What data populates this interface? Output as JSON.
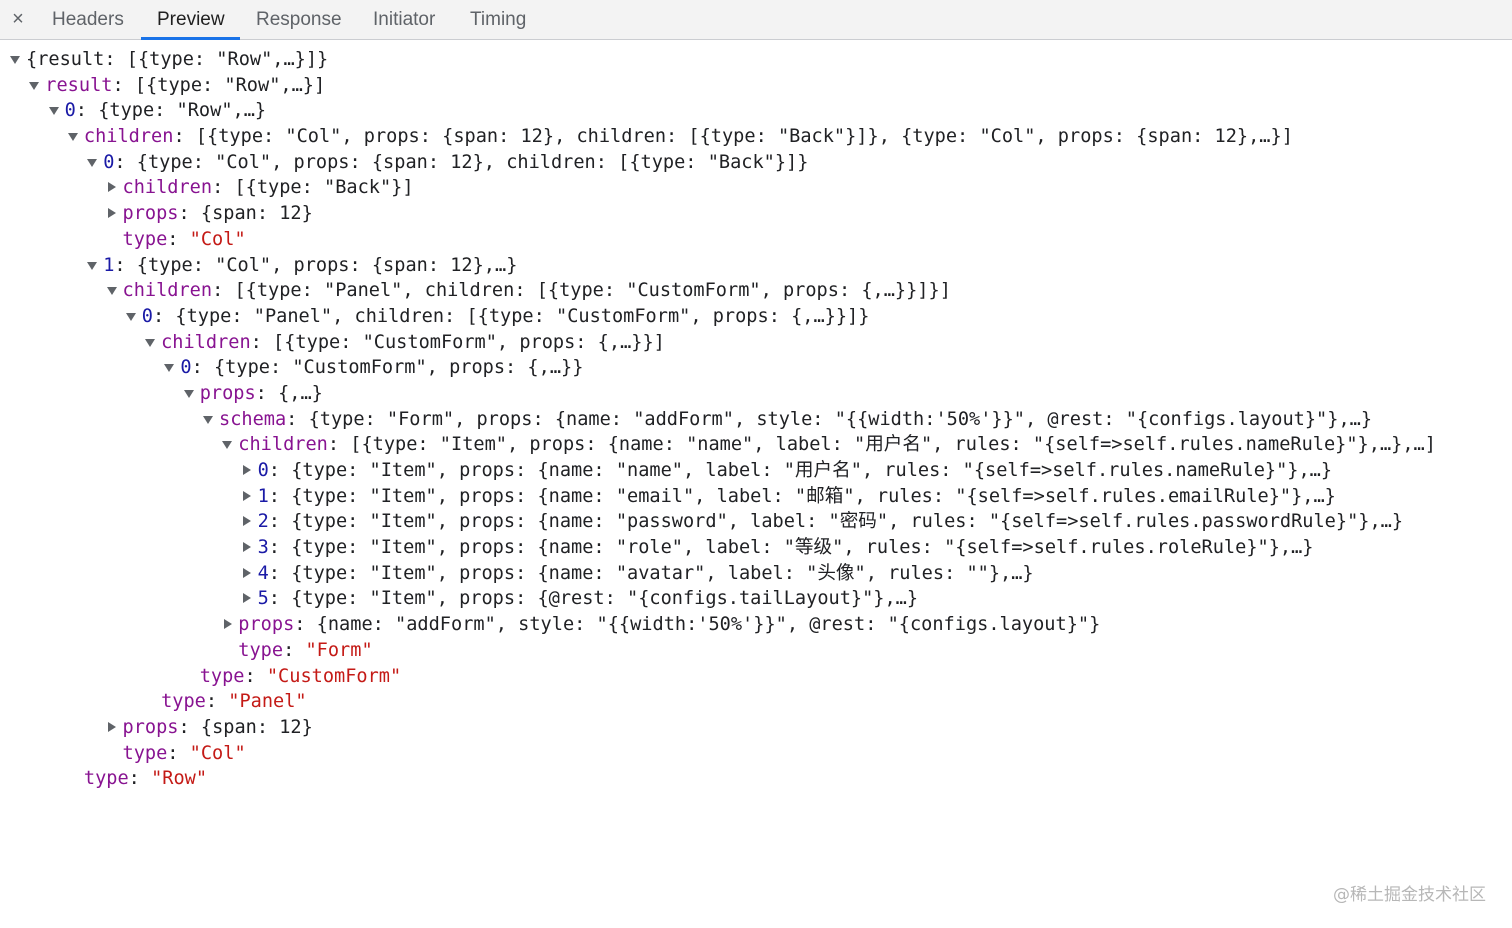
{
  "tabs": {
    "close_icon": "×",
    "items": [
      {
        "label": "Headers",
        "active": false
      },
      {
        "label": "Preview",
        "active": true
      },
      {
        "label": "Response",
        "active": false
      },
      {
        "label": "Initiator",
        "active": false
      },
      {
        "label": "Timing",
        "active": false
      }
    ]
  },
  "tree": {
    "lines": [
      {
        "key": "",
        "value": "{result: [{type: \"Row\",…}]}",
        "expanded": true
      },
      {
        "key": "result",
        "value": "[{type: \"Row\",…}]",
        "expanded": true
      },
      {
        "key": "0",
        "value": "{type: \"Row\",…}",
        "expanded": true
      },
      {
        "key": "children",
        "value": "[{type: \"Col\", props: {span: 12}, children: [{type: \"Back\"}]}, {type: \"Col\", props: {span: 12},…}]",
        "expanded": true
      },
      {
        "key": "0",
        "value": "{type: \"Col\", props: {span: 12}, children: [{type: \"Back\"}]}",
        "expanded": true
      },
      {
        "key": "children",
        "value": "[{type: \"Back\"}]",
        "expanded": false
      },
      {
        "key": "props",
        "value": "{span: 12}",
        "expanded": false
      },
      {
        "key": "type",
        "value": "\"Col\""
      },
      {
        "key": "1",
        "value": "{type: \"Col\", props: {span: 12},…}",
        "expanded": true
      },
      {
        "key": "children",
        "value": "[{type: \"Panel\", children: [{type: \"CustomForm\", props: {,…}}]}]",
        "expanded": true
      },
      {
        "key": "0",
        "value": "{type: \"Panel\", children: [{type: \"CustomForm\", props: {,…}}]}",
        "expanded": true
      },
      {
        "key": "children",
        "value": "[{type: \"CustomForm\", props: {,…}}]",
        "expanded": true
      },
      {
        "key": "0",
        "value": "{type: \"CustomForm\", props: {,…}}",
        "expanded": true
      },
      {
        "key": "props",
        "value": "{,…}",
        "expanded": true
      },
      {
        "key": "schema",
        "value": "{type: \"Form\", props: {name: \"addForm\", style: \"{{width:'50%'}}\", @rest: \"{configs.layout}\"},…}",
        "expanded": true
      },
      {
        "key": "children",
        "value": "[{type: \"Item\", props: {name: \"name\", label: \"用户名\", rules: \"{self=>self.rules.nameRule}\"},…},…]",
        "expanded": true
      },
      {
        "key": "0",
        "value": "{type: \"Item\", props: {name: \"name\", label: \"用户名\", rules: \"{self=>self.rules.nameRule}\"},…}",
        "expanded": false
      },
      {
        "key": "1",
        "value": "{type: \"Item\", props: {name: \"email\", label: \"邮箱\", rules: \"{self=>self.rules.emailRule}\"},…}",
        "expanded": false
      },
      {
        "key": "2",
        "value": "{type: \"Item\", props: {name: \"password\", label: \"密码\", rules: \"{self=>self.rules.passwordRule}\"},…}",
        "expanded": false
      },
      {
        "key": "3",
        "value": "{type: \"Item\", props: {name: \"role\", label: \"等级\", rules: \"{self=>self.rules.roleRule}\"},…}",
        "expanded": false
      },
      {
        "key": "4",
        "value": "{type: \"Item\", props: {name: \"avatar\", label: \"头像\", rules: \"\"},…}",
        "expanded": false
      },
      {
        "key": "5",
        "value": "{type: \"Item\", props: {@rest: \"{configs.tailLayout}\"},…}",
        "expanded": false
      },
      {
        "key": "props",
        "value": "{name: \"addForm\", style: \"{{width:'50%'}}\", @rest: \"{configs.layout}\"}",
        "expanded": false
      },
      {
        "key": "type",
        "value": "\"Form\""
      },
      {
        "key": "type",
        "value": "\"CustomForm\""
      },
      {
        "key": "type",
        "value": "\"Panel\""
      },
      {
        "key": "props",
        "value": "{span: 12}",
        "expanded": false
      },
      {
        "key": "type",
        "value": "\"Col\""
      },
      {
        "key": "type",
        "value": "\"Row\""
      }
    ]
  },
  "watermark": "@稀土掘金技术社区",
  "colors": {
    "key": "#881391",
    "index_key": "#1a1aa6",
    "string_value": "#c41a16",
    "text": "#202124",
    "tab_active_underline": "#1a73e8"
  }
}
